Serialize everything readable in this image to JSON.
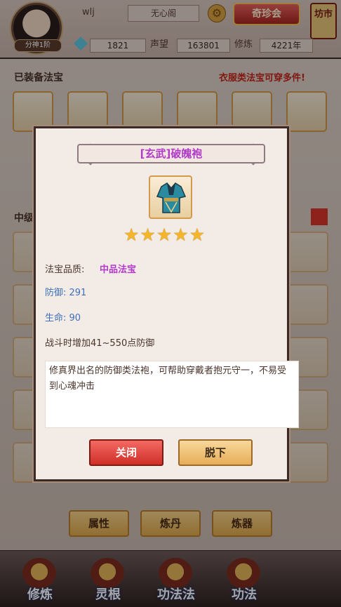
{
  "player": {
    "name": "wlj",
    "rank_badge": "分神1阶",
    "sect": "无心阁",
    "gems": "1821",
    "reputation_label": "声望",
    "reputation": "163801",
    "cultivation_label": "修炼",
    "cultivation": "4221年"
  },
  "header": {
    "treasure_button": "奇珍会",
    "market_button": "坊市"
  },
  "equipped": {
    "title": "已装备法宝",
    "notice": "衣服类法宝可穿多件!",
    "side_tag": "中级"
  },
  "bottom_buttons": [
    "属性",
    "炼丹",
    "炼器"
  ],
  "navbar": [
    "修炼",
    "灵根",
    "功法法",
    "功法"
  ],
  "modal": {
    "title": "[玄武]破魄袍",
    "stars": 5,
    "quality_label": "法宝品质:",
    "quality_value": "中品法宝",
    "defense": "防御: 291",
    "life": "生命: 90",
    "effect": "战斗时增加41~550点防御",
    "description": "修真界出名的防御类法袍，可帮助穿戴者抱元守一，不易受到心魂冲击",
    "close_button": "关闭",
    "remove_button": "脱下"
  },
  "colors": {
    "quality": "#b13ac8",
    "stat": "#3e6fb8",
    "title": "#b13ac8"
  },
  "icons": {
    "robe": "robe-icon",
    "star": "star-icon",
    "gear": "gear-icon"
  }
}
